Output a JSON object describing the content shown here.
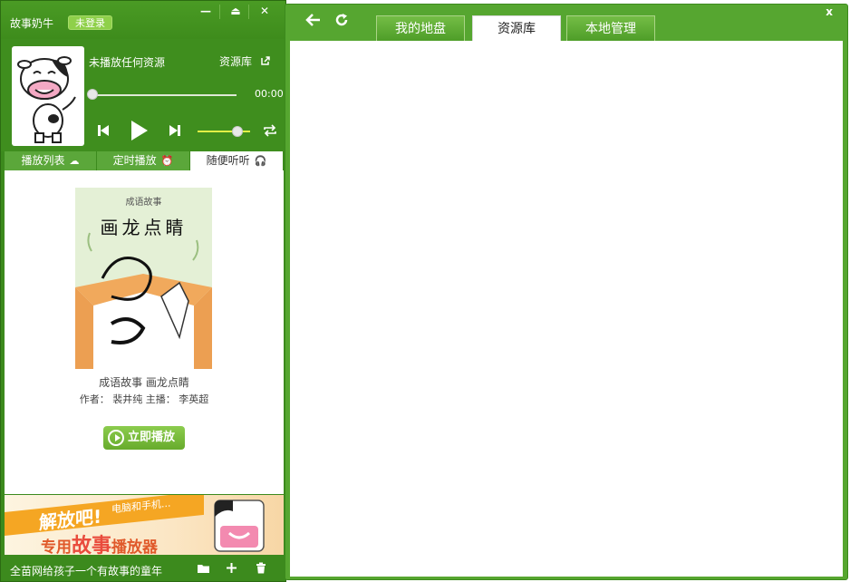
{
  "app": {
    "name": "故事奶牛",
    "login_status": "未登录",
    "window_controls": {
      "minimize": "—",
      "mini_mode": "⏏",
      "close": "✕"
    }
  },
  "player": {
    "now_playing": "未播放任何资源",
    "library_link": "资源库",
    "time": "00:00",
    "progress": 0,
    "volume": 0.7,
    "icons": [
      "prev-icon",
      "play-icon",
      "next-icon",
      "repeat-icon"
    ]
  },
  "left_tabs": [
    {
      "label": "播放列表",
      "icon": "cloud-icon",
      "glyph": "☁"
    },
    {
      "label": "定时播放",
      "icon": "alarm-icon",
      "glyph": "⏰"
    },
    {
      "label": "随便听听",
      "icon": "headphones-icon",
      "glyph": "🎧"
    }
  ],
  "featured": {
    "series": "成语故事",
    "cover_title": "画龙点睛",
    "caption": "成语故事 画龙点睛",
    "author_label": "作者：",
    "author": "裴井纯",
    "host_label": "主播：",
    "host": "李英超",
    "play_button": "立即播放"
  },
  "banner": {
    "headline": "解放吧!",
    "sub": "电脑和手机...",
    "line2_prefix": "专用",
    "line2_big": "故事",
    "line2_suffix": "播放器"
  },
  "footer": {
    "slogan": "全苗网给孩子一个有故事的童年",
    "icons": [
      "folder-icon",
      "add-icon",
      "trash-icon"
    ]
  },
  "browser": {
    "tabs": [
      "我的地盘",
      "资源库",
      "本地管理"
    ],
    "active_tab": 1,
    "close": "x"
  },
  "colors": {
    "brand_green": "#3c8a1d",
    "light_green": "#8fd04a",
    "volume_yellow": "#e2ef46",
    "play_button_green": "#67ab2c"
  }
}
